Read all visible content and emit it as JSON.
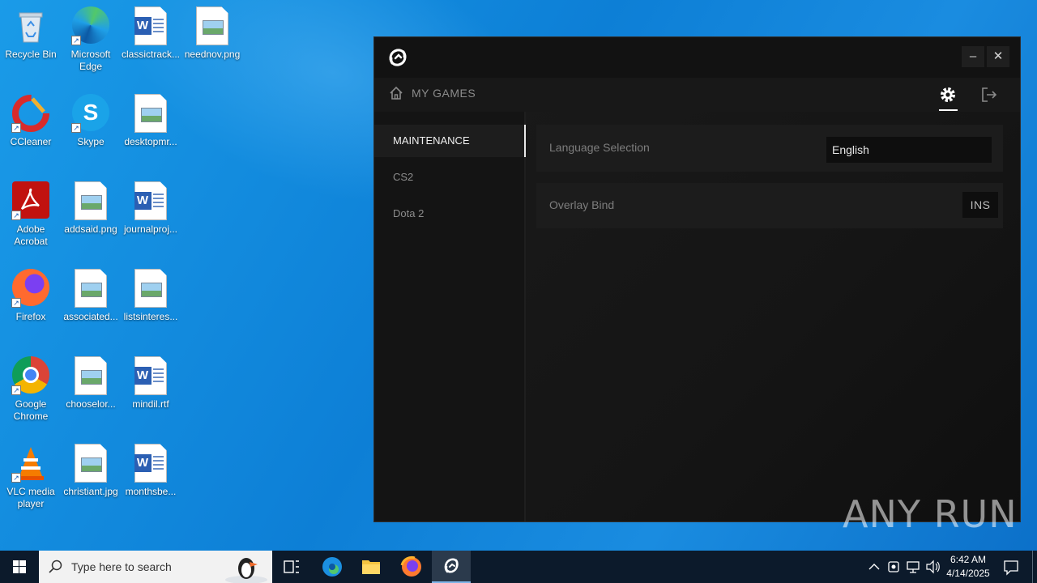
{
  "desktop": {
    "icons": [
      {
        "label": "Recycle Bin",
        "icon": "recycle-bin-icon"
      },
      {
        "label": "Microsoft Edge",
        "icon": "edge-icon"
      },
      {
        "label": "classictrack...",
        "icon": "word-document-icon"
      },
      {
        "label": "neednov.png",
        "icon": "image-file-icon"
      },
      {
        "label": "CCleaner",
        "icon": "ccleaner-icon"
      },
      {
        "label": "Skype",
        "icon": "skype-icon"
      },
      {
        "label": "desktopmr...",
        "icon": "image-file-icon"
      },
      {
        "label": "Adobe Acrobat",
        "icon": "acrobat-icon"
      },
      {
        "label": "addsaid.png",
        "icon": "image-file-icon"
      },
      {
        "label": "journalproj...",
        "icon": "word-document-icon"
      },
      {
        "label": "Firefox",
        "icon": "firefox-icon"
      },
      {
        "label": "associated...",
        "icon": "image-file-icon"
      },
      {
        "label": "listsinteres...",
        "icon": "image-file-icon"
      },
      {
        "label": "Google Chrome",
        "icon": "chrome-icon"
      },
      {
        "label": "chooselor...",
        "icon": "image-file-icon"
      },
      {
        "label": "mindil.rtf",
        "icon": "word-document-icon"
      },
      {
        "label": "VLC media player",
        "icon": "vlc-icon"
      },
      {
        "label": "christiant.jpg",
        "icon": "image-file-icon"
      },
      {
        "label": "monthsbe...",
        "icon": "word-document-icon"
      }
    ]
  },
  "app": {
    "minimize_label": "–",
    "close_label": "✕",
    "nav": {
      "my_games": "MY GAMES"
    },
    "sidebar": [
      {
        "label": "MAINTENANCE",
        "active": true
      },
      {
        "label": "CS2",
        "active": false
      },
      {
        "label": "Dota 2",
        "active": false
      }
    ],
    "settings": {
      "language": {
        "label": "Language Selection",
        "value": "English"
      },
      "overlay": {
        "label": "Overlay Bind",
        "value": "INS"
      }
    }
  },
  "watermark": "ANY RUN",
  "taskbar": {
    "search_placeholder": "Type here to search",
    "time": "6:42 AM",
    "date": "4/14/2025"
  }
}
